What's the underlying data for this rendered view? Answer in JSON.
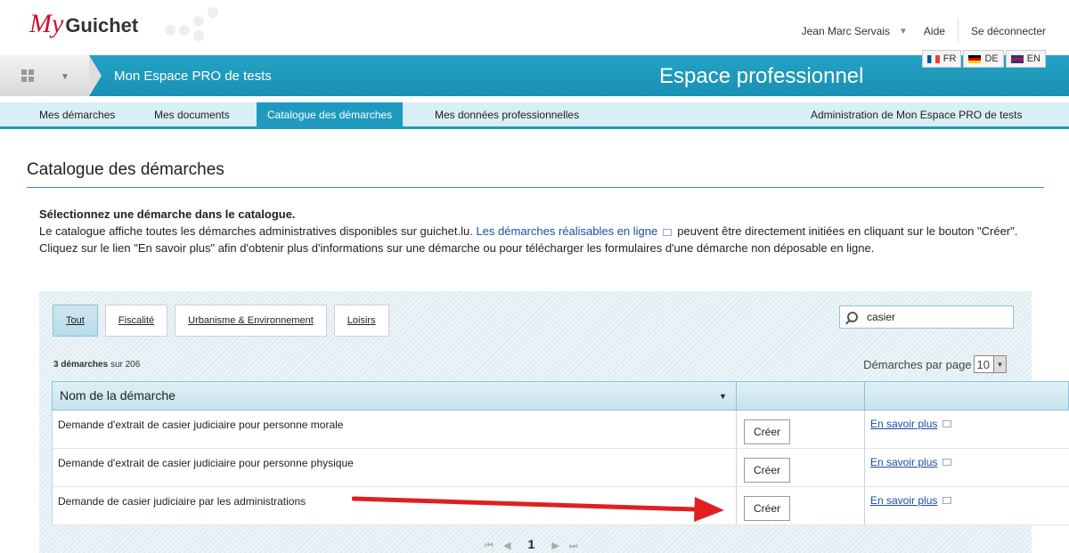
{
  "logo": {
    "my": "My",
    "guichet": "Guichet"
  },
  "user_menu": {
    "name": "Jean Marc Servais",
    "help": "Aide",
    "logout": "Se déconnecter"
  },
  "languages": [
    "FR",
    "DE",
    "EN"
  ],
  "space_name": "Mon Espace PRO de tests",
  "espace_title": "Espace professionnel",
  "nav": {
    "items": [
      "Mes démarches",
      "Mes documents",
      "Catalogue des démarches",
      "Mes données professionnelles"
    ],
    "admin": "Administration de Mon Espace PRO de tests"
  },
  "page_title": "Catalogue des démarches",
  "intro": {
    "heading": "Sélectionnez une démarche dans le catalogue.",
    "line1_a": "Le catalogue affiche toutes les démarches administratives disponibles sur guichet.lu.",
    "link": "Les démarches réalisables en ligne",
    "line1_b": "peuvent être directement initiées en cliquant sur le bouton \"Créer\".",
    "line2": "Cliquez sur le lien \"En savoir plus\" afin d'obtenir plus d'informations sur une démarche ou pour télécharger les formulaires d'une démarche non déposable en ligne."
  },
  "tabs": [
    "Tout",
    "Fiscalité",
    "Urbanisme & Environnement",
    "Loisirs"
  ],
  "search": {
    "value": "casier"
  },
  "count": {
    "bold": "3 démarches",
    "rest": "sur 206"
  },
  "per_page": {
    "label": "Démarches par page",
    "value": "10"
  },
  "table": {
    "header": "Nom de la démarche",
    "rows": [
      {
        "name": "Demande d'extrait de casier judiciaire pour personne morale",
        "create": "Créer",
        "more": "En savoir plus"
      },
      {
        "name": "Demande d'extrait de casier judiciaire pour personne physique",
        "create": "Créer",
        "more": "En savoir plus"
      },
      {
        "name": "Demande de casier judiciaire par les administrations",
        "create": "Créer",
        "more": "En savoir plus"
      }
    ]
  },
  "pager": {
    "current": "1"
  },
  "colors": {
    "primary": "#1f9abe",
    "brand_red": "#c8102e",
    "arrow": "#e02020"
  }
}
